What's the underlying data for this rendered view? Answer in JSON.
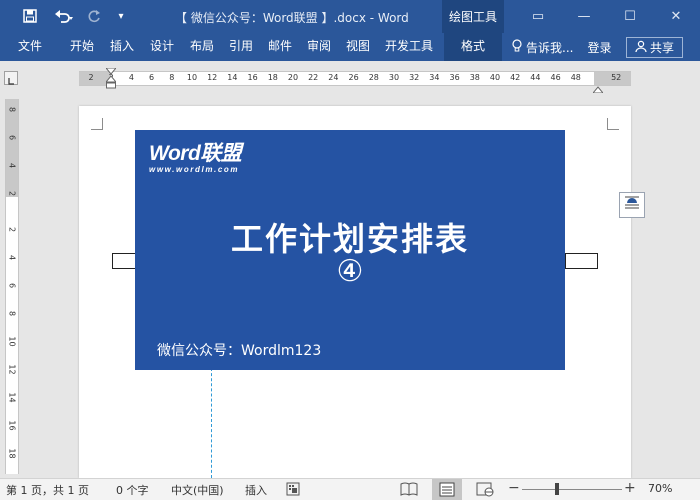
{
  "window": {
    "title": "【 微信公众号：Word联盟 】.docx - Word",
    "context_tab_group": "绘图工具",
    "controls": {
      "ribbon_display": "▭",
      "minimize": "—",
      "maximize": "☐",
      "close": "✕"
    }
  },
  "quick_access": {
    "save_icon": "save-icon",
    "undo_icon": "undo-icon",
    "redo_icon": "redo-icon",
    "customize": "▾"
  },
  "ribbon": {
    "tabs": [
      "文件",
      "开始",
      "插入",
      "设计",
      "布局",
      "引用",
      "邮件",
      "审阅",
      "视图",
      "开发工具"
    ],
    "context_tab": "格式",
    "tell_me": "告诉我...",
    "sign_in": "登录",
    "share": "共享"
  },
  "ruler": {
    "horizontal": [
      "2",
      "2",
      "4",
      "6",
      "8",
      "10",
      "12",
      "14",
      "16",
      "18",
      "20",
      "22",
      "24",
      "26",
      "28",
      "30",
      "32",
      "34",
      "36",
      "38",
      "40",
      "42",
      "44",
      "46",
      "48",
      "52"
    ],
    "vertical": [
      "8",
      "6",
      "4",
      "2",
      "2",
      "4",
      "6",
      "8",
      "10",
      "12",
      "14",
      "16",
      "18"
    ]
  },
  "document": {
    "cover": {
      "logo_text": "Word联盟",
      "logo_url": "www.wordlm.com",
      "title": "工作计划安排表",
      "number": "④",
      "footer": "微信公众号：Wordlm123"
    }
  },
  "status_bar": {
    "page": "第 1 页，共 1 页",
    "words": "0 个字",
    "language": "中文(中国)",
    "insert_mode": "插入",
    "zoom_level": "70%",
    "zoom_fraction": 0.35
  },
  "colors": {
    "title_bar": "#2b579a",
    "context_tab": "#1f467f",
    "cover_background": "#2553a3",
    "anchor_line": "#2f9ad6"
  }
}
